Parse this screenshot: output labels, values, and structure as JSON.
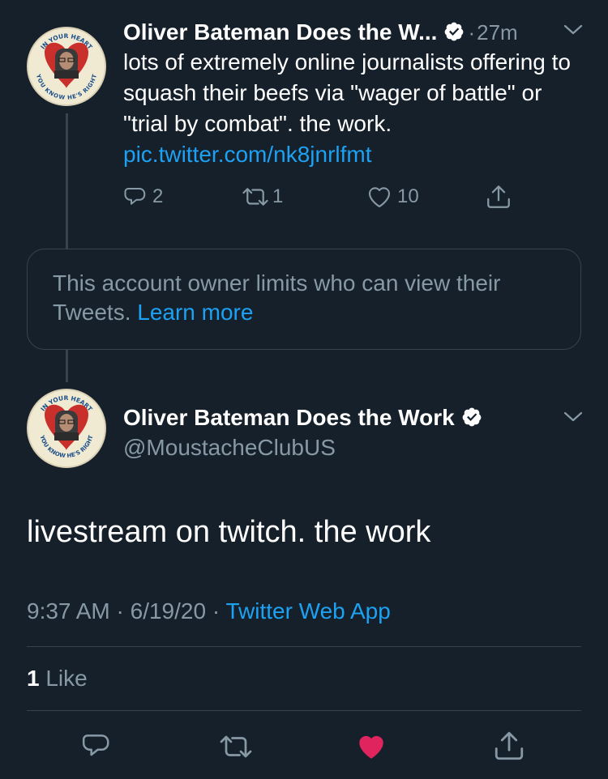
{
  "reply_tweet": {
    "author_name": "Oliver Bateman Does the W...",
    "separator": "·",
    "time": "27m",
    "text": "lots of extremely online journalists offering to squash their beefs via \"wager of battle\" or \"trial by combat\". the work.",
    "link": "pic.twitter.com/nk8jnrlfmt",
    "replies": "2",
    "retweets": "1",
    "likes": "10"
  },
  "notice": {
    "text": "This account owner limits who can view their Tweets.",
    "link": "Learn more"
  },
  "main_tweet": {
    "author_name": "Oliver Bateman Does the Work",
    "handle": "@MoustacheClubUS",
    "text": "livestream on twitch. the work",
    "time": "9:37 AM",
    "date": "6/19/20",
    "separator": "·",
    "source": "Twitter Web App",
    "like_count": "1",
    "like_label": "Like"
  },
  "avatar_badge_text": {
    "top": "IN YOUR HEART",
    "bottom": "YOU KNOW HE'S RIGHT"
  },
  "colors": {
    "background": "#15202b",
    "accent": "#1da1f2",
    "muted": "#8899a6",
    "like_active": "#e0245e"
  }
}
